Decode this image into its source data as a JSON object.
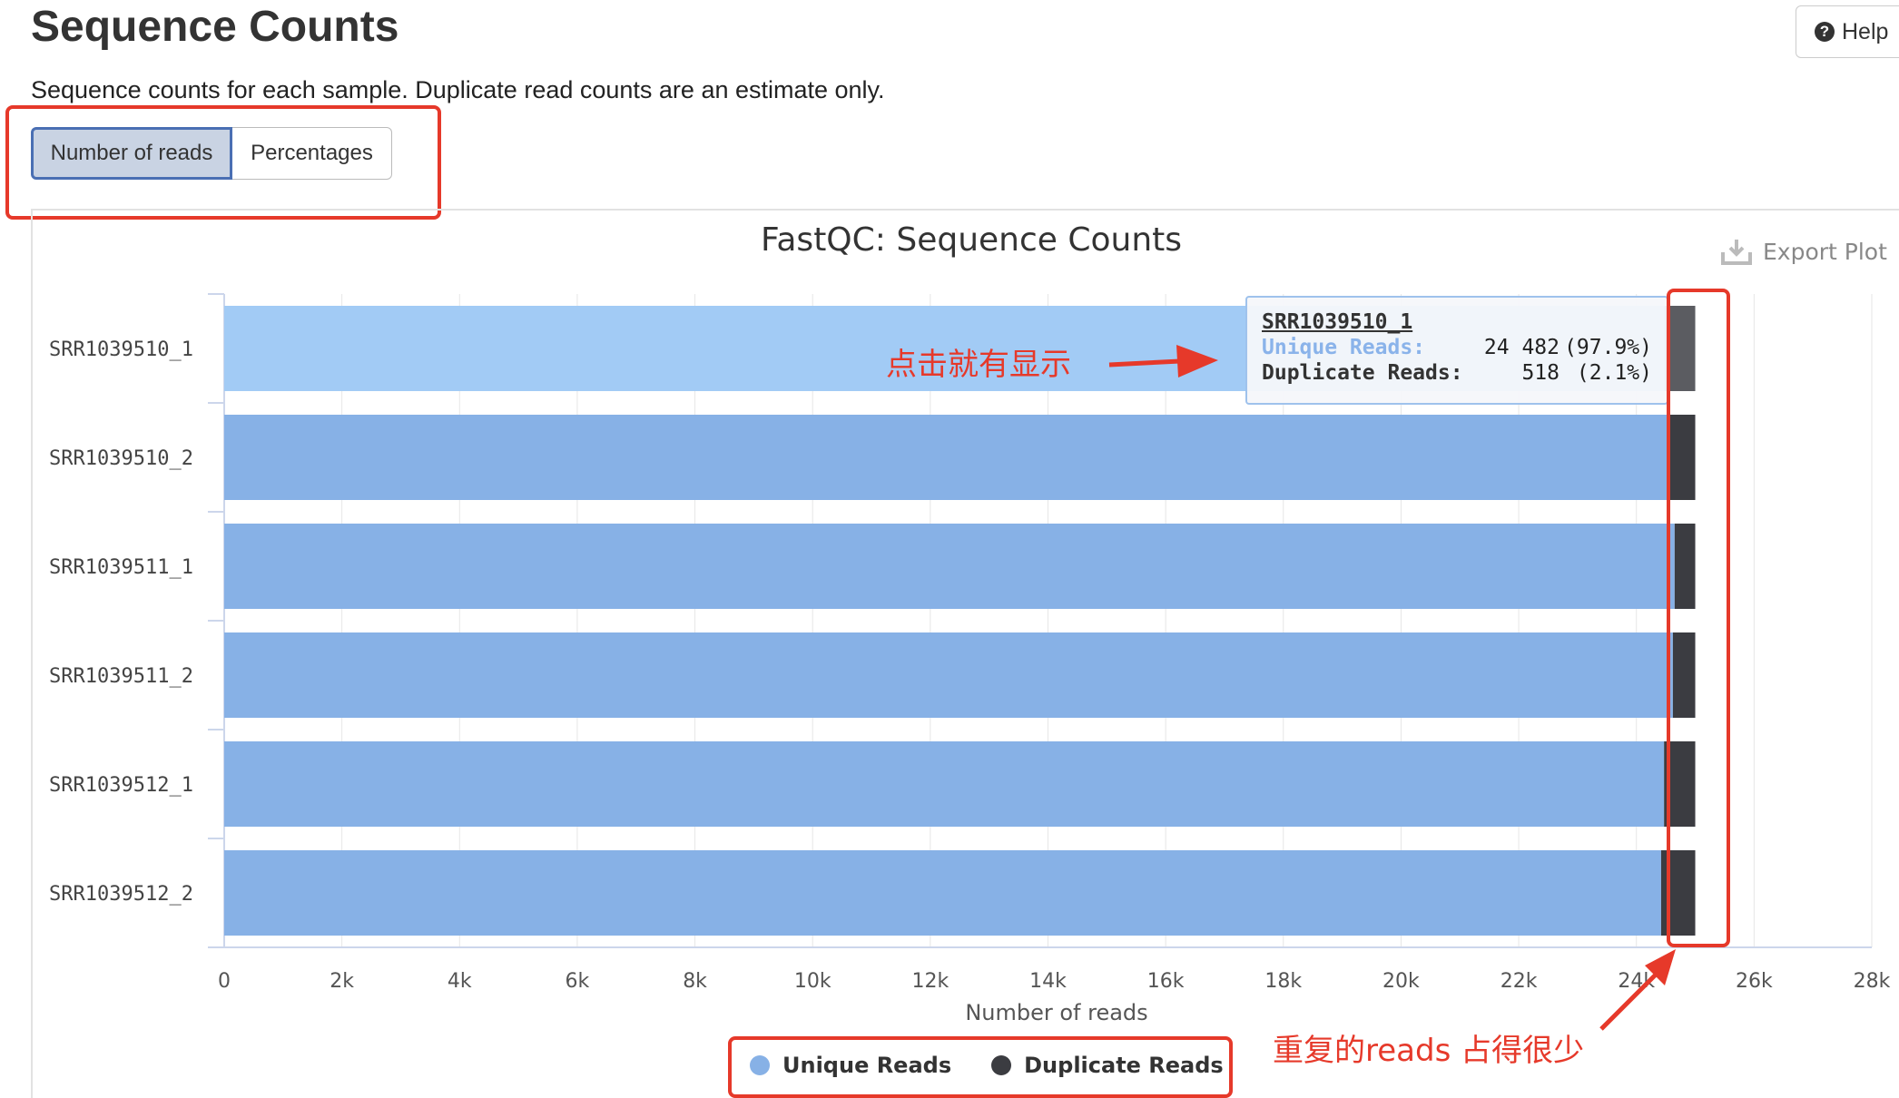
{
  "page": {
    "title": "Sequence Counts",
    "description": "Sequence counts for each sample. Duplicate read counts are an estimate only.",
    "help_label": "Help"
  },
  "toggle": {
    "options": [
      "Number of reads",
      "Percentages"
    ],
    "selected": "Number of reads"
  },
  "export_label": "Export Plot",
  "tooltip": {
    "sample": "SRR1039510_1",
    "unique_label": "Unique Reads:",
    "unique_value": "24 482",
    "unique_pct": "(97.9%)",
    "duplicate_label": "Duplicate Reads:",
    "duplicate_value": "518",
    "duplicate_pct": "(2.1%)"
  },
  "annotations": {
    "click_note": "点击就有显示",
    "dup_note": "重复的reads 占得很少"
  },
  "colors": {
    "unique": "#87b1e6",
    "unique_highlight": "#a2cbf5",
    "duplicate": "#3b3c41",
    "duplicate_highlight": "#5b5c61",
    "annotation": "#e6392a"
  },
  "chart_data": {
    "type": "bar",
    "orientation": "horizontal",
    "stacked": true,
    "title": "FastQC: Sequence Counts",
    "xlabel": "Number of reads",
    "ylabel": "",
    "xlim": [
      0,
      28000
    ],
    "x_tick_labels": [
      "0",
      "2k",
      "4k",
      "6k",
      "8k",
      "10k",
      "12k",
      "14k",
      "16k",
      "18k",
      "20k",
      "22k",
      "24k",
      "26k",
      "28k"
    ],
    "categories": [
      "SRR1039510_1",
      "SRR1039510_2",
      "SRR1039511_1",
      "SRR1039511_2",
      "SRR1039512_1",
      "SRR1039512_2"
    ],
    "series": [
      {
        "name": "Unique Reads",
        "values": [
          24482,
          24560,
          24650,
          24620,
          24470,
          24420
        ]
      },
      {
        "name": "Duplicate Reads",
        "values": [
          518,
          440,
          350,
          380,
          530,
          580
        ]
      }
    ],
    "legend_position": "bottom-center",
    "grid": true,
    "highlighted_category": "SRR1039510_1"
  }
}
